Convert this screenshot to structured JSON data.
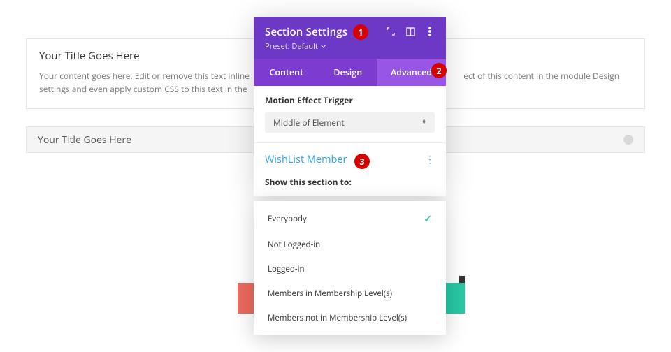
{
  "page": {
    "block1": {
      "title": "Your Title Goes Here",
      "body_left": "Your content goes here. Edit or remove this text inline",
      "body_right": "ect of this content in the module Design settings and even apply custom CSS to this text in the "
    },
    "block2": {
      "title": "Your Title Goes Here"
    }
  },
  "modal": {
    "title": "Section Settings",
    "preset_label": "Preset: Default",
    "tabs": {
      "content": "Content",
      "design": "Design",
      "advanced": "Advanced"
    },
    "motion": {
      "label": "Motion Effect Trigger",
      "value": "Middle of Element"
    },
    "wlm": {
      "title": "WishList Member",
      "show_label": "Show this section to:"
    }
  },
  "dropdown": {
    "options": {
      "o0": "Everybody",
      "o1": "Not Logged-in",
      "o2": "Logged-in",
      "o3": "Members in Membership Level(s)",
      "o4": "Members not in Membership Level(s)"
    }
  },
  "badges": {
    "b1": "1",
    "b2": "2",
    "b3": "3"
  }
}
